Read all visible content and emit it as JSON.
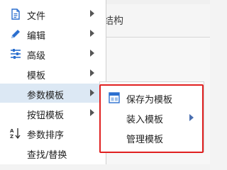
{
  "background": {
    "toolbar_fragment": "结构"
  },
  "menu": {
    "items": [
      {
        "label": "文件",
        "icon": "file-icon",
        "has_submenu": true
      },
      {
        "label": "编辑",
        "icon": "pencil-icon",
        "has_submenu": true
      },
      {
        "label": "高级",
        "icon": "sliders-icon",
        "has_submenu": true
      },
      {
        "label": "模板",
        "icon": "",
        "has_submenu": true
      },
      {
        "label": "参数模板",
        "icon": "",
        "has_submenu": true,
        "active": true
      },
      {
        "label": "按钮模板",
        "icon": "",
        "has_submenu": true
      },
      {
        "label": "参数排序",
        "icon": "sort-az-icon",
        "has_submenu": false
      },
      {
        "label": "查找/替换",
        "icon": "",
        "has_submenu": false
      }
    ]
  },
  "submenu": {
    "items": [
      {
        "label": "保存为模板",
        "icon": "save-template-icon",
        "has_submenu": false
      },
      {
        "label": "装入模板",
        "icon": "",
        "has_submenu": true
      },
      {
        "label": "管理模板",
        "icon": "",
        "has_submenu": false
      }
    ]
  },
  "colors": {
    "accent": "#2b6fcf",
    "active_row": "#dce8f4",
    "highlight_border": "#e02020"
  }
}
